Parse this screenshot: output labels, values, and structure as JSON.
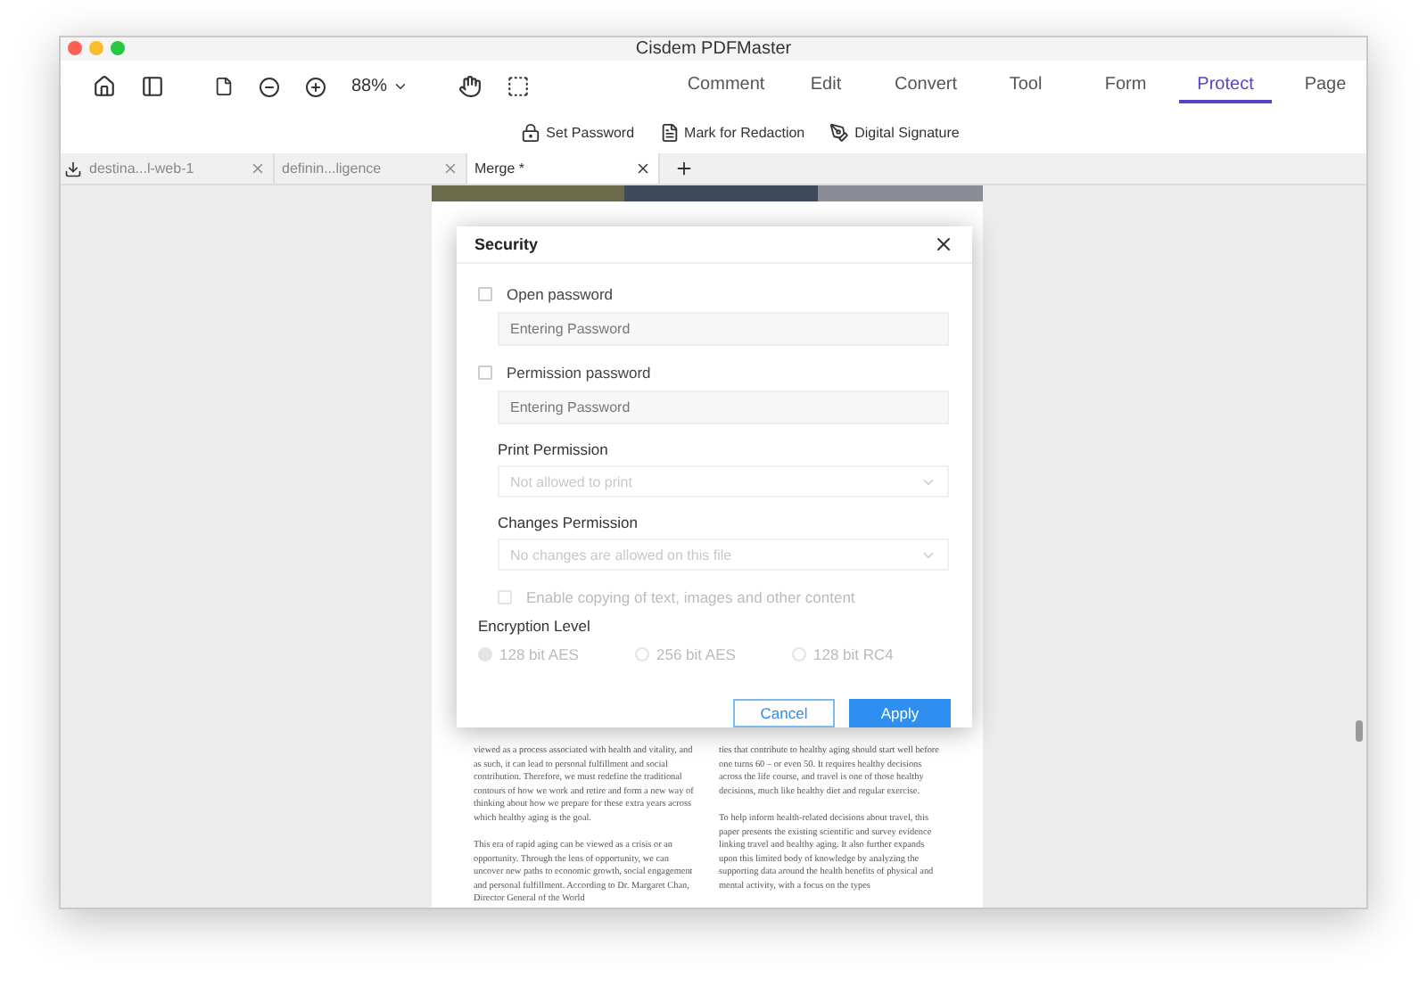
{
  "window": {
    "title": "Cisdem PDFMaster"
  },
  "toolbar": {
    "zoom": "88%",
    "menu": [
      {
        "label": "Comment",
        "selected": false
      },
      {
        "label": "Edit",
        "selected": false
      },
      {
        "label": "Convert",
        "selected": false
      },
      {
        "label": "Tool",
        "selected": false
      },
      {
        "label": "Form",
        "selected": false
      },
      {
        "label": "Protect",
        "selected": true
      },
      {
        "label": "Page",
        "selected": false
      }
    ]
  },
  "protect_tools": [
    {
      "kind": "lock",
      "label": "Set Password"
    },
    {
      "kind": "redact",
      "label": "Mark for Redaction"
    },
    {
      "kind": "sign",
      "label": "Digital Signature"
    }
  ],
  "tabs": [
    {
      "label": "destina...l-web-1",
      "selected": false
    },
    {
      "label": "definin...ligence",
      "selected": false
    },
    {
      "label": "Merge *",
      "selected": true
    }
  ],
  "document": {
    "columns": [
      {
        "paragraphs": [
          "viewed as a process associated with health and vitality, and as such, it can lead to personal fulfillment and social contribution. Therefore, we must redefine the traditional contours of how we work and retire and form a new way of thinking about how we prepare for these extra years across which healthy aging is the goal.",
          "This era of rapid aging can be viewed as a crisis or an opportunity. Through the lens of opportunity, we can uncover new paths to economic growth, social engagement and personal fulfillment. According to Dr. Margaret Chan, Director General of the World"
        ]
      },
      {
        "paragraphs": [
          "ties that contribute to healthy aging should start well before one turns 60 – or even 50. It requires healthy decisions across the life course, and travel is one of those healthy decisions, much like healthy diet and regular exercise.",
          "To help inform health-related decisions about travel, this paper presents the existing scientific and survey evidence linking travel and healthy aging. It also further expands upon this limited body of knowledge by analyzing the supporting data around the health benefits of physical and mental activity, with a focus on the types"
        ]
      }
    ]
  },
  "dialog": {
    "title": "Security",
    "open_password": {
      "label": "Open password",
      "checked": false,
      "placeholder": "Entering Password"
    },
    "permission_password": {
      "label": "Permission password",
      "checked": false,
      "placeholder": "Entering Password"
    },
    "print_permission": {
      "label": "Print Permission",
      "value": "Not allowed to print",
      "disabled": true
    },
    "changes_permission": {
      "label": "Changes Permission",
      "value": "No changes are allowed on this file",
      "disabled": true
    },
    "enable_copying": {
      "label": "Enable copying of text, images and other content",
      "checked": false,
      "disabled": true
    },
    "encryption": {
      "label": "Encryption Level",
      "options": [
        {
          "label": "128 bit AES",
          "selected": true,
          "disabled": true
        },
        {
          "label": "256 bit AES",
          "selected": false,
          "disabled": true
        },
        {
          "label": "128 bit RC4",
          "selected": false,
          "disabled": true
        }
      ]
    },
    "buttons": [
      {
        "kind": "secondary",
        "label": "Cancel"
      },
      {
        "kind": "primary",
        "label": "Apply"
      }
    ]
  }
}
